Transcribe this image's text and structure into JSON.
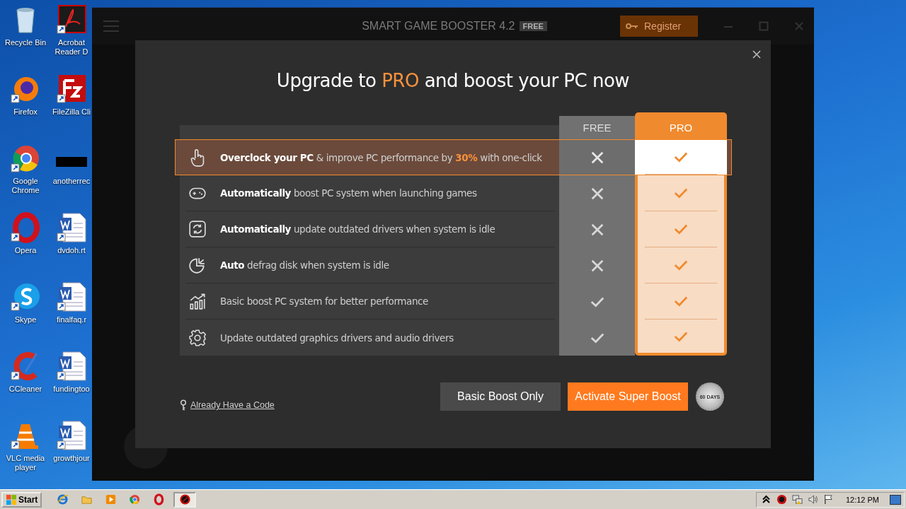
{
  "desktop": {
    "icons": [
      {
        "label": "Recycle Bin",
        "kind": "bin"
      },
      {
        "label": "Acrobat Reader D",
        "kind": "pdf"
      },
      {
        "label": "Firefox",
        "kind": "firefox"
      },
      {
        "label": "FileZilla Cli",
        "kind": "filezilla"
      },
      {
        "label": "Google Chrome",
        "kind": "chrome"
      },
      {
        "label": "anotherrec",
        "kind": "blank"
      },
      {
        "label": "Opera",
        "kind": "opera"
      },
      {
        "label": "dvdoh.rt",
        "kind": "word"
      },
      {
        "label": "Skype",
        "kind": "skype"
      },
      {
        "label": "finalfaq.r",
        "kind": "word"
      },
      {
        "label": "CCleaner",
        "kind": "ccleaner"
      },
      {
        "label": "fundingtoo",
        "kind": "word"
      },
      {
        "label": "VLC media player",
        "kind": "vlc"
      },
      {
        "label": "growthjour",
        "kind": "word"
      }
    ]
  },
  "app": {
    "title": "SMART GAME BOOSTER 4.2",
    "edition": "FREE",
    "register": "Register"
  },
  "dialog": {
    "title_start": "Upgrade to ",
    "title_accent": "PRO",
    "title_end": " and boost your PC now",
    "columns": [
      "FREE",
      "PRO"
    ],
    "features": [
      {
        "kind": "hand",
        "text": "**Overclock your PC** & improve PC performance by **30%** with one-click",
        "free": false,
        "pro": true,
        "selected": true
      },
      {
        "kind": "gamepad",
        "text": "**Automatically** boost PC system when launching games",
        "free": false,
        "pro": true,
        "selected": false
      },
      {
        "kind": "refresh",
        "text": "**Automatically** update outdated drivers when system is idle",
        "free": false,
        "pro": true,
        "selected": false
      },
      {
        "kind": "pie",
        "text": "**Auto** defrag disk when system is idle",
        "free": false,
        "pro": true,
        "selected": false
      },
      {
        "kind": "chart",
        "text": "Basic boost PC system for better performance",
        "free": true,
        "pro": true,
        "selected": false
      },
      {
        "kind": "gear",
        "text": "Update outdated graphics drivers and audio drivers",
        "free": true,
        "pro": true,
        "selected": false
      }
    ],
    "link": "Already Have a Code",
    "buttons": [
      {
        "label": "Basic Boost Only",
        "kind": "secondary"
      },
      {
        "label": "Activate Super Boost",
        "kind": "primary"
      }
    ],
    "seal": "60 DAYS"
  },
  "taskbar": {
    "start": "Start",
    "apps": [
      {
        "kind": "ie",
        "active": false
      },
      {
        "kind": "folder",
        "active": false
      },
      {
        "kind": "media",
        "active": false
      },
      {
        "kind": "chrome",
        "active": false
      },
      {
        "kind": "opera",
        "active": false
      },
      {
        "kind": "booster",
        "active": true
      }
    ],
    "clock": "12:12 PM"
  }
}
